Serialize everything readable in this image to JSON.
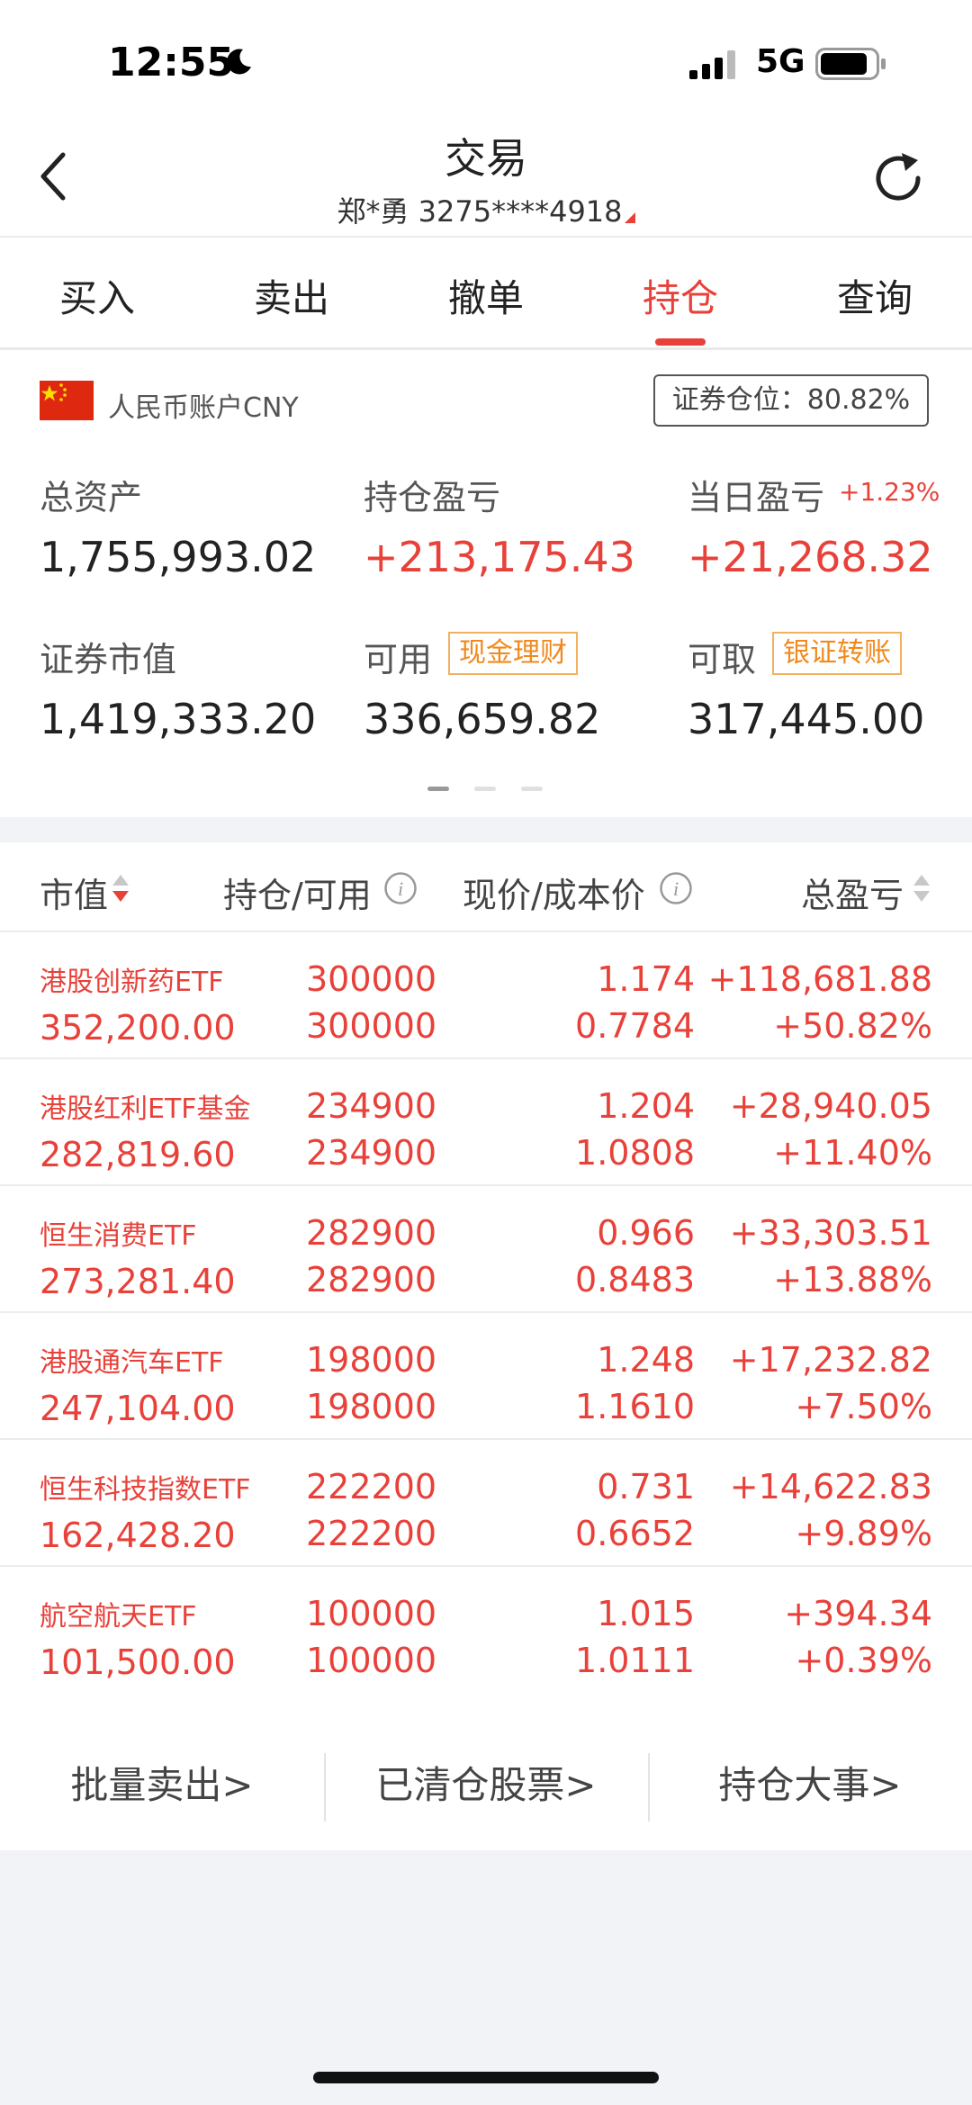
{
  "status_bar": {
    "time": "12:55",
    "network": "5G"
  },
  "header": {
    "title": "交易",
    "account": "郑*勇 3275****4918"
  },
  "tabs": [
    {
      "label": "买入",
      "active": false
    },
    {
      "label": "卖出",
      "active": false
    },
    {
      "label": "撤单",
      "active": false
    },
    {
      "label": "持仓",
      "active": true
    },
    {
      "label": "查询",
      "active": false
    }
  ],
  "summary": {
    "currency": "人民币账户CNY",
    "position_ratio": "证券仓位：80.82%",
    "total_assets_label": "总资产",
    "total_assets": "1,755,993.02",
    "holding_pl_label": "持仓盈亏",
    "holding_pl": "+213,175.43",
    "daily_pl_label": "当日盈亏",
    "daily_pl_pct": "+1.23%",
    "daily_pl": "+21,268.32",
    "market_value_label": "证券市值",
    "market_value": "1,419,333.20",
    "available_label": "可用",
    "available_tag": "现金理财",
    "available": "336,659.82",
    "withdrawable_label": "可取",
    "withdrawable_tag": "银证转账",
    "withdrawable": "317,445.00"
  },
  "table": {
    "headers": {
      "market_value": "市值",
      "position": "持仓/可用",
      "price": "现价/成本价",
      "total_pl": "总盈亏"
    },
    "rows": [
      {
        "name": "港股创新药ETF",
        "market_value": "352,200.00",
        "position": "300000",
        "available": "300000",
        "price": "1.174",
        "cost": "0.7784",
        "pl": "+118,681.88",
        "pl_pct": "+50.82%"
      },
      {
        "name": "港股红利ETF基金",
        "market_value": "282,819.60",
        "position": "234900",
        "available": "234900",
        "price": "1.204",
        "cost": "1.0808",
        "pl": "+28,940.05",
        "pl_pct": "+11.40%"
      },
      {
        "name": "恒生消费ETF",
        "market_value": "273,281.40",
        "position": "282900",
        "available": "282900",
        "price": "0.966",
        "cost": "0.8483",
        "pl": "+33,303.51",
        "pl_pct": "+13.88%"
      },
      {
        "name": "港股通汽车ETF",
        "market_value": "247,104.00",
        "position": "198000",
        "available": "198000",
        "price": "1.248",
        "cost": "1.1610",
        "pl": "+17,232.82",
        "pl_pct": "+7.50%"
      },
      {
        "name": "恒生科技指数ETF",
        "market_value": "162,428.20",
        "position": "222200",
        "available": "222200",
        "price": "0.731",
        "cost": "0.6652",
        "pl": "+14,622.83",
        "pl_pct": "+9.89%"
      },
      {
        "name": "航空航天ETF",
        "market_value": "101,500.00",
        "position": "100000",
        "available": "100000",
        "price": "1.015",
        "cost": "1.0111",
        "pl": "+394.34",
        "pl_pct": "+0.39%"
      }
    ]
  },
  "actions": [
    {
      "label": "批量卖出>"
    },
    {
      "label": "已清仓股票>"
    },
    {
      "label": "持仓大事>"
    }
  ],
  "colors": {
    "accent": "#e8413a",
    "tag": "#f08a1d",
    "background": "#f2f3f6"
  },
  "icons": [
    "moon-icon",
    "signal-icon",
    "battery-icon",
    "back-arrow-icon",
    "refresh-icon",
    "china-flag-icon",
    "sort-icon",
    "info-icon"
  ]
}
